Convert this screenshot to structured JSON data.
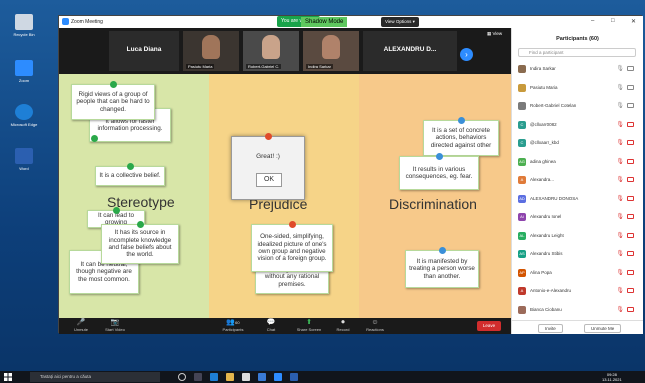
{
  "desktop": {
    "icons": [
      {
        "label": "Recycle Bin",
        "color": "#cfd8e3"
      },
      {
        "label": "Zoom",
        "color": "#2d8cff"
      },
      {
        "label": "Microsoft Edge",
        "color": "#1e7fd6"
      },
      {
        "label": "Word",
        "color": "#2b5fb0"
      }
    ]
  },
  "window": {
    "title": "Zoom Meeting",
    "view_banner": "You are viewing",
    "shadow_mode": "Shadow Mode",
    "view_options": "View Options ▾",
    "minimize": "–",
    "maximize": "□",
    "close": "✕"
  },
  "strip": {
    "tiles": [
      {
        "name": "",
        "big_name": "Luca Diana"
      },
      {
        "name": "Pasiutu Maria",
        "big_name": ""
      },
      {
        "name": "Robert-Gabriel C.",
        "big_name": ""
      },
      {
        "name": "Indira Sarkar",
        "big_name": ""
      },
      {
        "name": "",
        "big_name": "ALEXANDRU D..."
      }
    ],
    "next": "›",
    "view_label": "▦ View"
  },
  "board": {
    "headings": [
      "Stereotype",
      "Prejudice",
      "Discrimination"
    ],
    "colors": {
      "stereotype": "#d8e6a8",
      "prejudice": "#f6d488",
      "discrimination": "#f7c98a"
    },
    "notes": [
      {
        "text": "Rigid views of a group of people that can be hard to changed.",
        "pin": "#2aa84a"
      },
      {
        "text": "It allows for faster information processing.",
        "pin": "#2aa84a"
      },
      {
        "text": "It is a collective belief.",
        "pin": "#2aa84a"
      },
      {
        "text": "It can lead to growing",
        "pin": "#2aa84a"
      },
      {
        "text": "It has its source in incomplete knowledge and false beliefs about the world.",
        "pin": "#2aa84a"
      },
      {
        "text": "It can be neutral, though negative are the most common.",
        "pin": "#2aa84a"
      },
      {
        "text": "One-sided, simplifying, idealized picture of one's own group and negative vision of a foreign group.",
        "pin": "#e04b2a"
      },
      {
        "text": "something or someone without any rational premises.",
        "pin": "#e04b2a"
      },
      {
        "text": "It is a set of concrete actions, behaviors directed against other",
        "pin": "#3a8fd8"
      },
      {
        "text": "It results in various consequences, eg. fear.",
        "pin": "#3a8fd8"
      },
      {
        "text": "It is manifested by treating a person worse than another.",
        "pin": "#3a8fd8"
      }
    ],
    "dialog": {
      "message": "Great! :)",
      "ok": "OK"
    }
  },
  "toolbar": {
    "items": [
      {
        "icon": "🎤",
        "label": "Unmute"
      },
      {
        "icon": "📷",
        "label": "Start Video"
      },
      {
        "icon": "👥",
        "label": "Participants"
      },
      {
        "icon": "💬",
        "label": "Chat"
      },
      {
        "icon": "⬆",
        "label": "Share Screen"
      },
      {
        "icon": "⏺",
        "label": "Record"
      },
      {
        "icon": "☺",
        "label": "Reactions"
      }
    ],
    "participants_count": "60",
    "leave": "Leave"
  },
  "panel": {
    "title": "Participants (60)",
    "search_placeholder": "Find a participant",
    "participants": [
      {
        "name": "Indira Sarkar",
        "initials": "",
        "color": "#8a6b4f"
      },
      {
        "name": "Pasiutu Maria",
        "initials": "",
        "color": "#c89a3c"
      },
      {
        "name": "Robert-Gabriel Cotelan",
        "initials": "",
        "color": "#7a7a7a"
      },
      {
        "name": "@cllxarr0082",
        "initials": "C",
        "color": "#2a9d8f"
      },
      {
        "name": "@cllxaarr_kbd",
        "initials": "C",
        "color": "#2a9d8f"
      },
      {
        "name": "adina ghinea",
        "initials": "AG",
        "color": "#4caf50"
      },
      {
        "name": "Alexandra...",
        "initials": "A",
        "color": "#e07b39"
      },
      {
        "name": "ALEXANDRU DONOSA",
        "initials": "AD",
        "color": "#5b6ee1"
      },
      {
        "name": "Alexandru Ionel",
        "initials": "AI",
        "color": "#8e44ad"
      },
      {
        "name": "Alexandru Leight",
        "initials": "AL",
        "color": "#27ae60"
      },
      {
        "name": "Alexandru Stibis",
        "initials": "AS",
        "color": "#16a085"
      },
      {
        "name": "Alina Popa",
        "initials": "AP",
        "color": "#d35400"
      },
      {
        "name": "Antonio-e-Alexandru",
        "initials": "A",
        "color": "#c0392b"
      },
      {
        "name": "Bianca Ciobanu",
        "initials": "",
        "color": "#9c6b5a"
      }
    ],
    "invite": "Invite",
    "unmute_me": "Unmute Me"
  },
  "taskbar": {
    "search": "Tastați aici pentru a căuta",
    "time": "09:28",
    "date": "13.11.2021"
  }
}
